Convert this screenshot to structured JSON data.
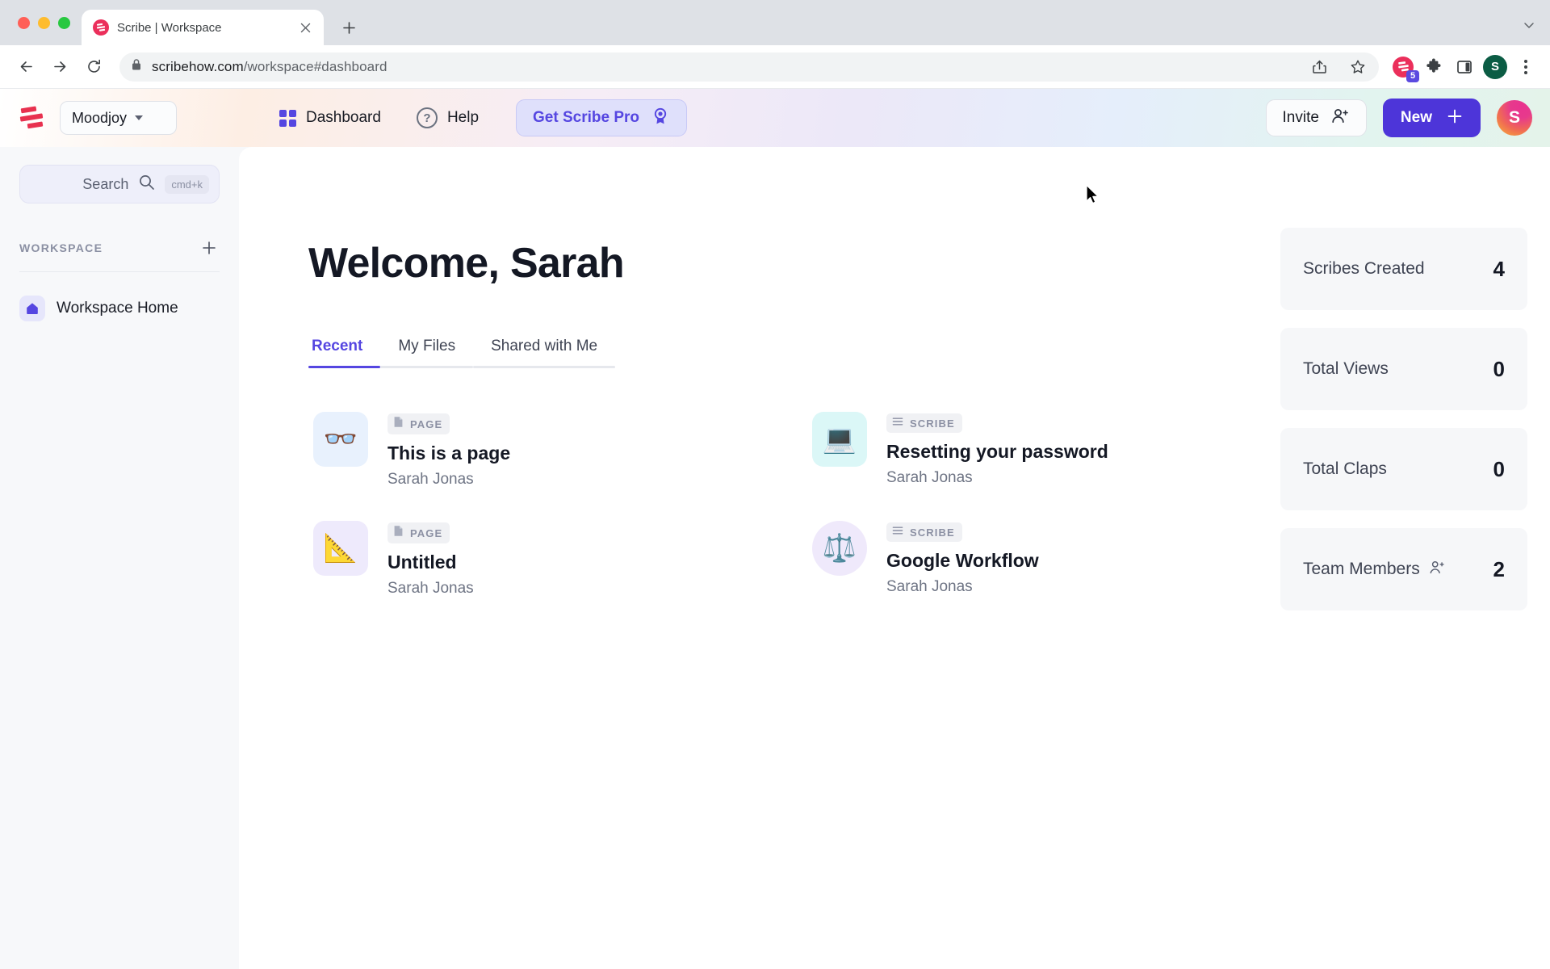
{
  "browser": {
    "tab": {
      "title": "Scribe | Workspace",
      "favicon": "scribe-favicon",
      "close": "✕"
    },
    "new_tab_label": "+",
    "url_primary": "scribehow.com",
    "url_secondary": "/workspace#dashboard",
    "extension_badge": "5",
    "profile_initial": "S",
    "icons": [
      "back-icon",
      "forward-icon",
      "reload-icon",
      "lock-icon",
      "share-icon",
      "bookmark-star-icon",
      "scribe-extension-icon",
      "extensions-puzzle-icon",
      "side-panel-icon",
      "browser-profile-icon",
      "browser-menu-icon"
    ]
  },
  "header": {
    "logo": "scribe-logo",
    "workspace": {
      "name": "Moodjoy"
    },
    "nav": [
      {
        "label": "Dashboard",
        "icon": "grid-icon"
      },
      {
        "label": "Help",
        "icon": "help-circle-icon"
      }
    ],
    "pro_button": {
      "label": "Get Scribe Pro",
      "icon": "award-ribbon-icon"
    },
    "invite_button": {
      "label": "Invite",
      "icon": "user-plus-icon"
    },
    "new_button": {
      "label": "New",
      "icon": "plus-icon"
    },
    "avatar_initial": "S"
  },
  "sidebar": {
    "search": {
      "label": "Search",
      "shortcut": "cmd+k",
      "icon": "search-icon"
    },
    "section_label": "WORKSPACE",
    "add_label": "+",
    "items": [
      {
        "label": "Workspace Home",
        "icon": "home-icon"
      }
    ]
  },
  "main": {
    "title": "Welcome, Sarah",
    "tabs": [
      {
        "label": "Recent",
        "active": true
      },
      {
        "label": "My Files",
        "active": false
      },
      {
        "label": "Shared with Me",
        "active": false
      }
    ],
    "cards": [
      {
        "badge": "PAGE",
        "badge_icon": "document-icon",
        "title": "This is a page",
        "author": "Sarah Jonas",
        "emoji": "👓",
        "thumb_bg": "#e8f1fd",
        "shape": "rounded"
      },
      {
        "badge": "SCRIBE",
        "badge_icon": "list-icon",
        "title": "Resetting your password",
        "author": "Sarah Jonas",
        "emoji": "💻",
        "thumb_bg": "#dbf7f7",
        "shape": "rounded"
      },
      {
        "badge": "PAGE",
        "badge_icon": "document-icon",
        "title": "Untitled",
        "author": "Sarah Jonas",
        "emoji": "📐",
        "thumb_bg": "#eeeafc",
        "shape": "rounded"
      },
      {
        "badge": "SCRIBE",
        "badge_icon": "list-icon",
        "title": "Google Workflow",
        "author": "Sarah Jonas",
        "emoji": "⚖️",
        "thumb_bg": "#efe9fb",
        "shape": "circle"
      }
    ],
    "stats": [
      {
        "label": "Scribes Created",
        "value": "4",
        "icon": null
      },
      {
        "label": "Total Views",
        "value": "0",
        "icon": null
      },
      {
        "label": "Total Claps",
        "value": "0",
        "icon": null
      },
      {
        "label": "Team Members",
        "value": "2",
        "icon": "user-plus-icon"
      }
    ]
  },
  "colors": {
    "accent_indigo": "#5546e1",
    "new_button": "#4d35d9",
    "scribe_red": "#eb2f5b",
    "pro_bg": "#dfe0fb",
    "stat_bg": "#f6f7f9"
  }
}
